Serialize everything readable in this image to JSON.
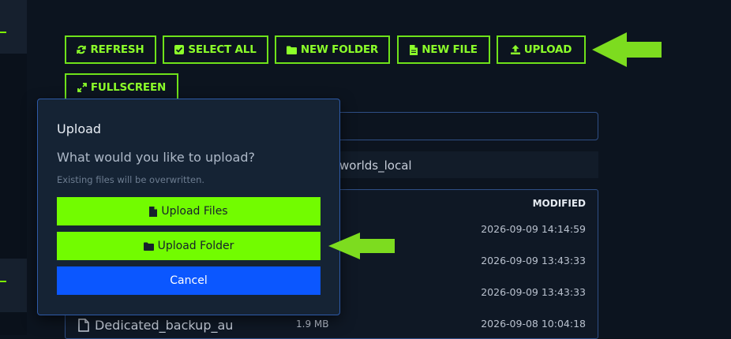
{
  "toolbar": {
    "refresh": "REFRESH",
    "select_all": "SELECT ALL",
    "new_folder": "NEW FOLDER",
    "new_file": "NEW FILE",
    "upload": "UPLOAD",
    "fullscreen": "FULLSCREEN"
  },
  "path": {
    "text": "worlds_local"
  },
  "table": {
    "modified_header": "MODIFIED",
    "rows": [
      {
        "name": "",
        "size": "",
        "modified": "2026-09-09 14:14:59"
      },
      {
        "name": "",
        "size": "",
        "modified": "2026-09-09 13:43:33"
      },
      {
        "name": "",
        "size": "",
        "modified": "2026-09-09 13:43:33"
      },
      {
        "name": "Dedicated_backup_au",
        "size": "1.9 MB",
        "modified": "2026-09-08 10:04:18"
      }
    ]
  },
  "modal": {
    "title": "Upload",
    "question": "What would you like to upload?",
    "note": "Existing files will be overwritten.",
    "upload_files": "Upload Files",
    "upload_folder": "Upload Folder",
    "cancel": "Cancel"
  },
  "colors": {
    "accent_green": "#72fc00",
    "toolbar_border": "#6fe21a",
    "cancel_blue": "#0b57ff",
    "arrow_green": "#7ddc1f",
    "background": "#0c141f"
  },
  "icons": [
    "refresh-icon",
    "checkbox-icon",
    "folder-icon",
    "file-icon",
    "upload-icon",
    "expand-icon"
  ]
}
